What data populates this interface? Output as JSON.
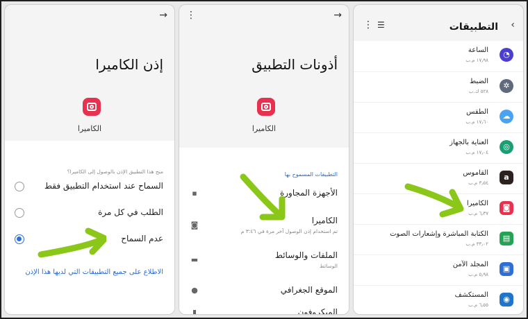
{
  "panel_permission": {
    "title": "إذن الكاميرا",
    "app_name": "الكاميرا",
    "hint": "منح هذا التطبيق الإذن بالوصول إلى الكاميرا؟",
    "options": [
      {
        "label": "السماح عند استخدام التطبيق فقط",
        "selected": false
      },
      {
        "label": "الطلب في كل مرة",
        "selected": false
      },
      {
        "label": "عدم السماح",
        "selected": true
      }
    ],
    "link": "الاطلاع على جميع التطبيقات التي لديها هذا الإذن"
  },
  "panel_app_permissions": {
    "title": "أذونات التطبيق",
    "app_name": "الكاميرا",
    "section_label": "التطبيقات المسموح بها",
    "items": [
      {
        "title": "الأجهزة المجاورة",
        "subtitle": ""
      },
      {
        "title": "الكاميرا",
        "subtitle": "تم استخدام إذن الوصول آخر مرة في ٣:٤٦ م"
      },
      {
        "title": "الملفات والوسائط",
        "subtitle": "الوسائط"
      },
      {
        "title": "الموقع الجغرافي",
        "subtitle": ""
      },
      {
        "title": "الميكروفون",
        "subtitle": ""
      }
    ]
  },
  "panel_apps": {
    "title": "التطبيقات",
    "apps": [
      {
        "name": "الساعة",
        "size": "١٧٫٩٨ م.ب",
        "icon": "clock-icon",
        "color": "#4a3fd1"
      },
      {
        "name": "الضبط",
        "size": "٥٢٨ ك.ب",
        "icon": "settings-icon",
        "color": "#5f6b7a"
      },
      {
        "name": "الطقس",
        "size": "١٧٫٦٠ م.ب",
        "icon": "weather-icon",
        "color": "#4aa3f0"
      },
      {
        "name": "العناية بالجهاز",
        "size": "١٧٫٠٤ م.ب",
        "icon": "device-care-icon",
        "color": "#1a9e73"
      },
      {
        "name": "القاموس",
        "size": "٣٫٥٤ م.ب",
        "icon": "dictionary-icon",
        "color": "#2b2220"
      },
      {
        "name": "الكاميرا",
        "size": "٦٫٣٧ م.ب",
        "icon": "camera-icon",
        "color": "#e8304f"
      },
      {
        "name": "الكتابة المباشرة وإشعارات الصوت",
        "size": "٣٣٫٠٢ م.ب",
        "icon": "live-transcribe-icon",
        "color": "#23a455"
      },
      {
        "name": "المجلد الآمن",
        "size": "٥٫٩٨ م.ب",
        "icon": "secure-folder-icon",
        "color": "#2e6fd6"
      },
      {
        "name": "المستكشف",
        "size": "٦٫٥٥ م.ب",
        "icon": "explorer-icon",
        "color": "#1f75c9"
      }
    ]
  },
  "colors": {
    "accent": "#2e6fd6",
    "camera": "#e8304f",
    "arrow": "#8ac718"
  }
}
